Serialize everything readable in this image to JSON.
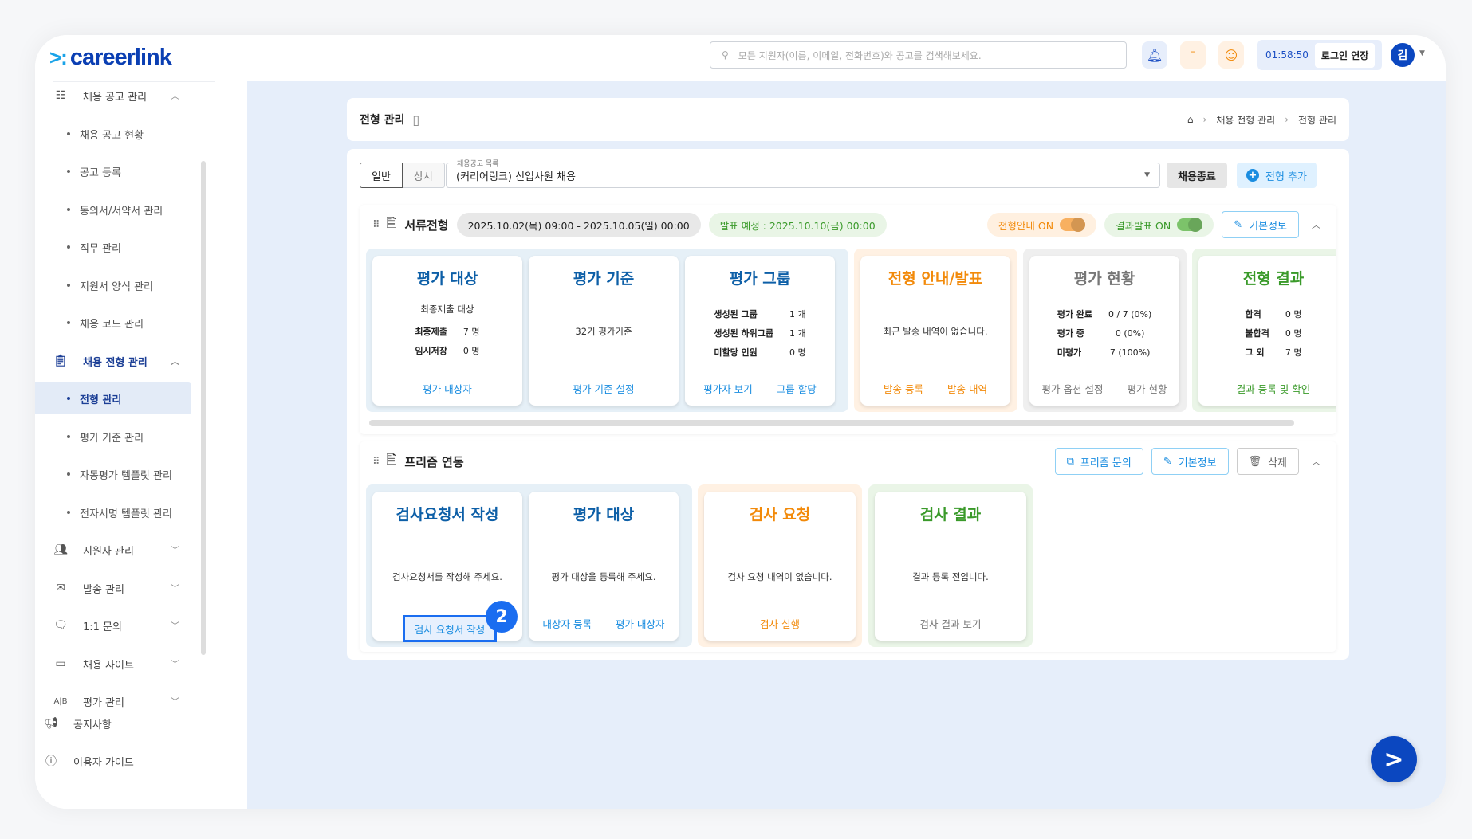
{
  "header": {
    "logo": "careerlink",
    "search_placeholder": "모든 지원자(이름, 이메일, 전화번호)와 공고를 검색해보세요.",
    "timer": "01:58:50",
    "extend_label": "로그인 연장",
    "avatar": "김"
  },
  "sidebar": {
    "groups": [
      {
        "label": "채용 공고 관리",
        "icon": "list-icon",
        "expanded": true,
        "items": [
          "채용 공고 현황",
          "공고 등록",
          "동의서/서약서 관리",
          "직무 관리",
          "지원서 양식 관리",
          "채용 코드 관리"
        ]
      },
      {
        "label": "채용 전형 관리",
        "icon": "clipboard-icon",
        "expanded": true,
        "items": [
          "전형 관리",
          "평가 기준 관리",
          "자동평가 템플릿 관리",
          "전자서명 템플릿 관리"
        ],
        "active": "전형 관리"
      },
      {
        "label": "지원자 관리",
        "icon": "users-icon"
      },
      {
        "label": "발송 관리",
        "icon": "mail-icon"
      },
      {
        "label": "1:1 문의",
        "icon": "chat-icon"
      },
      {
        "label": "채용 사이트",
        "icon": "window-icon"
      },
      {
        "label": "평가 관리",
        "icon": "ab-icon"
      }
    ],
    "footer": [
      "공지사항",
      "이용자 가이드"
    ]
  },
  "page": {
    "title": "전형 관리",
    "breadcrumb": [
      "채용 전형 관리",
      "전형 관리"
    ]
  },
  "toolbar": {
    "tabs": [
      "일반",
      "상시"
    ],
    "select_label": "채용공고 목록",
    "select_value": "(커리어링크) 신입사원 채용",
    "end_label": "채용종료",
    "add_label": "전형 추가"
  },
  "stage1": {
    "name": "서류전형",
    "period": "2025.10.02(목) 09:00 - 2025.10.05(일) 00:00",
    "announce": "발표 예정 : 2025.10.10(금) 00:00",
    "guide_toggle": "전형안내 ON",
    "result_toggle": "결과발표 ON",
    "info_label": "기본정보",
    "cards": [
      {
        "title": "평가 대상",
        "desc": "최종제출 대상",
        "rows": [
          [
            "최종제출",
            "7 명"
          ],
          [
            "임시저장",
            "0 명"
          ]
        ],
        "links": [
          "평가 대상자"
        ]
      },
      {
        "title": "평가 기준",
        "desc": "32기 평가기준",
        "links": [
          "평가 기준 설정"
        ]
      },
      {
        "title": "평가 그룹",
        "rows": [
          [
            "생성된 그룹",
            "1 개"
          ],
          [
            "생성된 하위그룹",
            "1 개"
          ],
          [
            "미할당 인원",
            "0 명"
          ]
        ],
        "links": [
          "평가자 보기",
          "그룹 할당"
        ]
      },
      {
        "title": "전형 안내/발표",
        "desc": "최근 발송 내역이 없습니다.",
        "links": [
          "발송 등록",
          "발송 내역"
        ]
      },
      {
        "title": "평가 현황",
        "rows": [
          [
            "평가 완료",
            "0 / 7 (0%)"
          ],
          [
            "평가 중",
            "0 (0%)"
          ],
          [
            "미평가",
            "7 (100%)"
          ]
        ],
        "links": [
          "평가 옵션 설정",
          "평가 현황"
        ]
      },
      {
        "title": "전형 결과",
        "rows": [
          [
            "합격",
            "0 명"
          ],
          [
            "불합격",
            "0 명"
          ],
          [
            "그 외",
            "7 명"
          ]
        ],
        "links": [
          "결과 등록 및 확인"
        ]
      }
    ]
  },
  "stage2": {
    "name": "프리즘 연동",
    "inquiry_label": "프리즘 문의",
    "info_label": "기본정보",
    "delete_label": "삭제",
    "cards": [
      {
        "title": "검사요청서 작성",
        "desc": "검사요청서를 작성해 주세요.",
        "links": [
          "검사 요청서 작성"
        ]
      },
      {
        "title": "평가 대상",
        "desc": "평가 대상을 등록해 주세요.",
        "links": [
          "대상자 등록",
          "평가 대상자"
        ]
      },
      {
        "title": "검사 요청",
        "desc": "검사 요청 내역이 없습니다.",
        "links": [
          "검사 실행"
        ]
      },
      {
        "title": "검사 결과",
        "desc": "결과 등록 전입니다.",
        "links": [
          "검사 결과 보기"
        ]
      }
    ]
  },
  "annotation": {
    "step": "2"
  },
  "colors": {
    "brand": "#0b47c0",
    "accent": "#1a8de0",
    "orange": "#f28a0a",
    "green": "#3a9a2a"
  }
}
